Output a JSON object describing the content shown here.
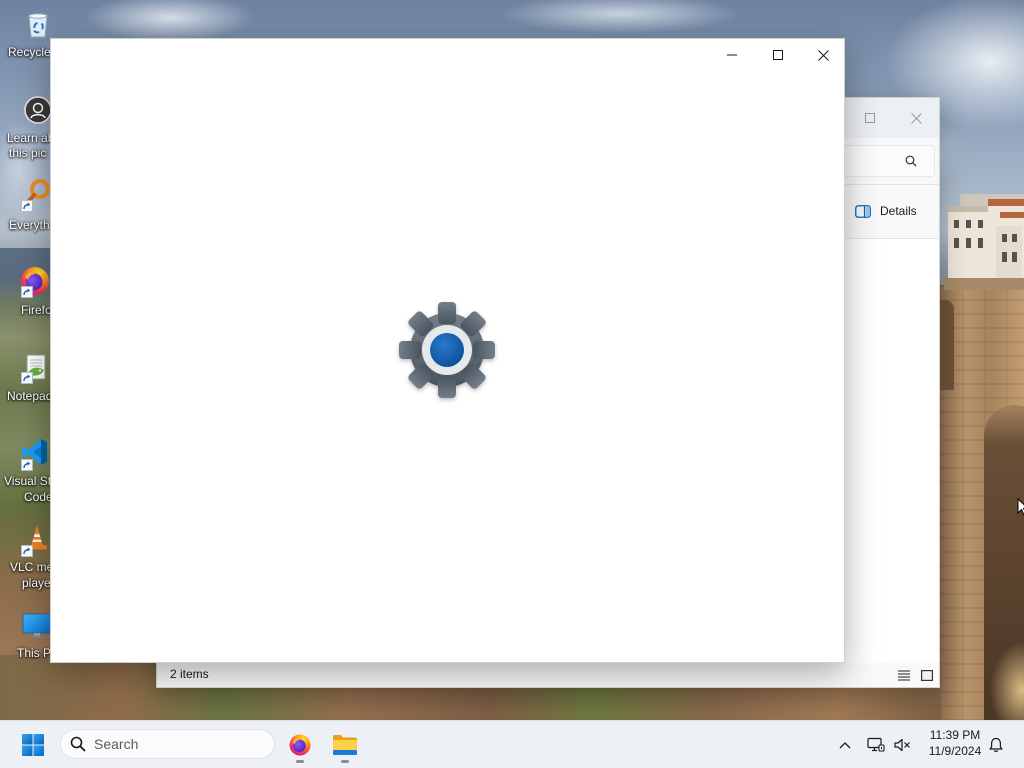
{
  "desktop": {
    "wallpaper": "landscape-photo",
    "icons": [
      {
        "icon": "recycle-bin-icon",
        "label": [
          "Recycle"
        ],
        "shortcut": false
      },
      {
        "icon": "learn-about-picture-icon",
        "label": [
          "Learn ab",
          "this pic"
        ],
        "shortcut": false
      },
      {
        "icon": "everything-search-icon",
        "label": [
          "Everyth"
        ],
        "shortcut": true
      },
      {
        "icon": "firefox-icon",
        "label": [
          "Firefo"
        ],
        "shortcut": true
      },
      {
        "icon": "notepad-plus-plus-icon",
        "label": [
          "Notepad"
        ],
        "shortcut": true
      },
      {
        "icon": "vscode-icon",
        "label": [
          "Visual St",
          "Code"
        ],
        "shortcut": true
      },
      {
        "icon": "vlc-icon",
        "label": [
          "VLC me",
          "playe"
        ],
        "shortcut": true
      },
      {
        "icon": "this-pc-icon",
        "label": [
          "This P"
        ],
        "shortcut": false
      }
    ]
  },
  "settings_window": {
    "logo_icon": "settings-gear-icon",
    "controls": [
      "minimize-icon",
      "maximize-icon",
      "close-icon"
    ]
  },
  "explorer_window": {
    "controls": [
      "maximize-icon",
      "close-icon"
    ],
    "search_icon": "search-icon",
    "toolbar": {
      "details_icon": "details-pane-icon",
      "details_label": "Details"
    },
    "status_text": "2 items",
    "view_icons": [
      "details-view-icon",
      "large-icons-view-icon"
    ]
  },
  "taskbar": {
    "start_icon": "windows-start-icon",
    "search": {
      "icon": "search-icon",
      "placeholder": "Search"
    },
    "pinned": [
      {
        "icon": "firefox-icon",
        "running": true
      },
      {
        "icon": "file-explorer-icon",
        "running": true
      }
    ],
    "tray": {
      "icons": [
        "chevron-up-icon",
        "network-icon",
        "volume-muted-icon"
      ],
      "time": "11:39 PM",
      "date": "11/9/2024",
      "notification_icon": "bell-icon"
    }
  },
  "colors": {
    "accent": "#0067c0",
    "settings_gear": "#5d6772",
    "settings_gear_center": "#0f5aa7",
    "taskbar_bg": "#edf0f5",
    "window_bg": "#ffffff",
    "desktop_label": "#ffffff"
  }
}
